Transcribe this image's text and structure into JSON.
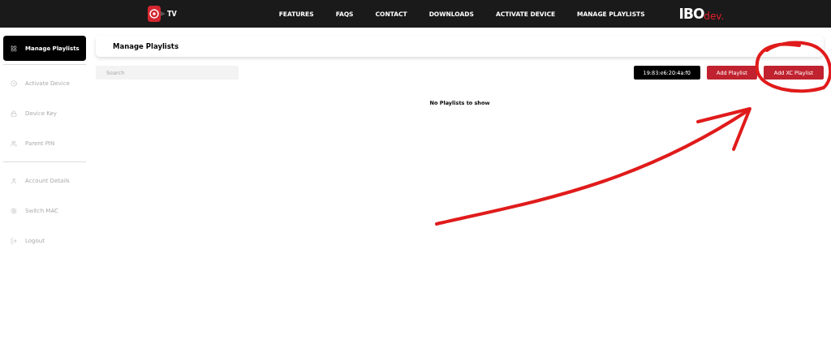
{
  "header": {
    "logo_text": "TV",
    "nav": [
      "FEATURES",
      "FAQS",
      "CONTACT",
      "DOWNLOADS",
      "ACTIVATE DEVICE",
      "MANAGE PLAYLISTS"
    ],
    "brand": {
      "main": "IBO",
      "suffix": "dev."
    }
  },
  "sidebar": {
    "sections": [
      [
        {
          "label": "Manage Playlists",
          "selected": true
        }
      ],
      [
        {
          "label": "Activate Device",
          "selected": false
        },
        {
          "label": "Device Key",
          "selected": false
        },
        {
          "label": "Parent PIN",
          "selected": false
        }
      ],
      [
        {
          "label": "Account Details",
          "selected": false
        },
        {
          "label": "Switch MAC",
          "selected": false
        },
        {
          "label": "Logout",
          "selected": false
        }
      ]
    ]
  },
  "page": {
    "title": "Manage Playlists",
    "search": {
      "placeholder": "Search"
    },
    "mac": "19:83:e6:20:4a:f0",
    "buttons": [
      "Add Playlist",
      "Add XC Playlist"
    ],
    "empty_message": "No Playlists to show"
  }
}
